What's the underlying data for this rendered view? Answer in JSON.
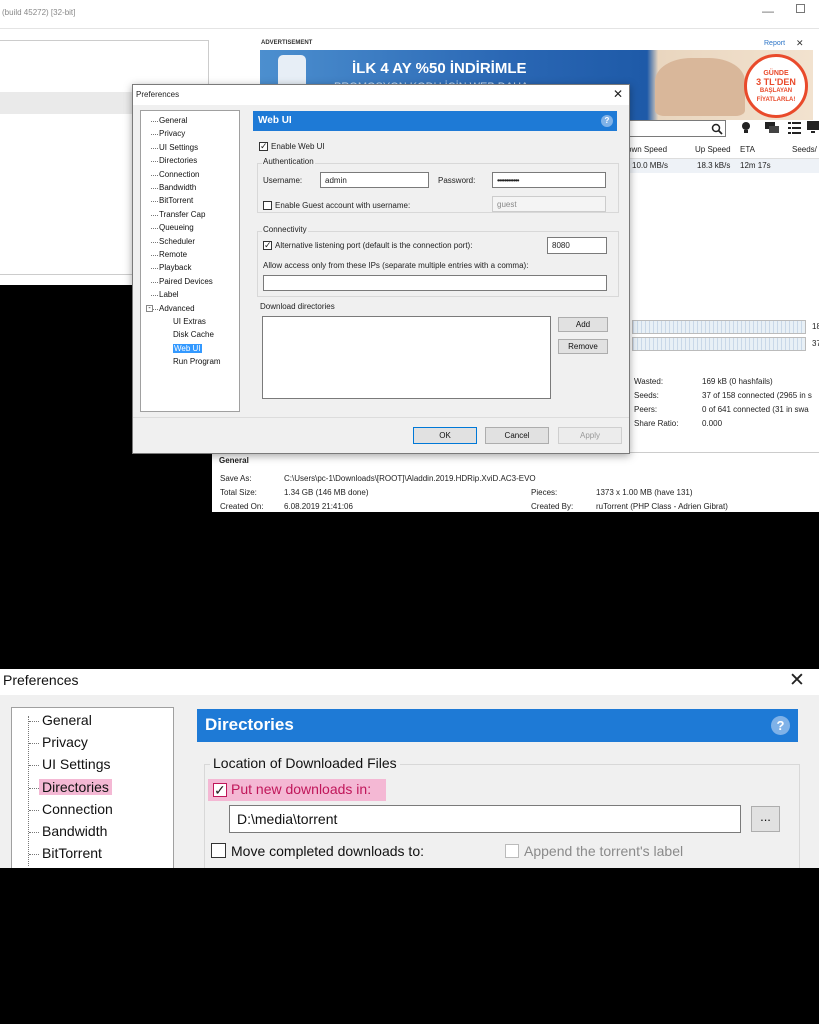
{
  "top": {
    "window_title": "(build 45272) [32-bit]",
    "ad": {
      "label": "ADVERTISEMENT",
      "report": "Report",
      "headline": "İLK 4 AY %50 İNDİRİMLE",
      "subline": "PROMOSYON KODU İÇİN WEB DAHA",
      "badge_line1": "GÜNDE",
      "badge_line2": "3 TL'DEN",
      "badge_line3": "BAŞLAYAN",
      "badge_line4": "FİYATLARLA!"
    },
    "search_placeholder": "ch",
    "columns": [
      "own Speed",
      "Up Speed",
      "ETA",
      "Seeds/"
    ],
    "row": {
      "down_speed": "10.0 MB/s",
      "up_speed": "18.3 kB/s",
      "eta": "12m 17s"
    },
    "side_numbers": [
      "18",
      "37"
    ],
    "stats": [
      {
        "label": "Wasted:",
        "value": "169 kB (0 hashfails)"
      },
      {
        "label": "Seeds:",
        "value": "37 of 158 connected (2965 in s"
      },
      {
        "label": "Peers:",
        "value": "0 of 641 connected (31 in swa"
      },
      {
        "label": "Share Ratio:",
        "value": "0.000"
      }
    ],
    "general": {
      "header": "General",
      "save_as_label": "Save As:",
      "save_as": "C:\\Users\\pc-1\\Downloads\\[ROOT]\\Aladdin.2019.HDRip.XviD.AC3-EVO",
      "total_size_label": "Total Size:",
      "total_size": "1.34 GB (146 MB done)",
      "created_on_label": "Created On:",
      "created_on": "6.08.2019 21:41:06",
      "pieces_label": "Pieces:",
      "pieces": "1373 x 1.00 MB (have 131)",
      "created_by_label": "Created By:",
      "created_by": "ruTorrent (PHP Class - Adrien Gibrat)"
    },
    "prefs": {
      "title": "Preferences",
      "tree": [
        "General",
        "Privacy",
        "UI Settings",
        "Directories",
        "Connection",
        "Bandwidth",
        "BitTorrent",
        "Transfer Cap",
        "Queueing",
        "Scheduler",
        "Remote",
        "Playback",
        "Paired Devices",
        "Label",
        "Advanced"
      ],
      "tree_children": [
        "UI Extras",
        "Disk Cache",
        "Web UI",
        "Run Program"
      ],
      "section_title": "Web UI",
      "enable_web_ui": "Enable Web UI",
      "authentication": "Authentication",
      "username_label": "Username:",
      "username": "admin",
      "password_label": "Password:",
      "password": "••••••••••••",
      "guest_label": "Enable Guest account with username:",
      "guest_value": "guest",
      "connectivity": "Connectivity",
      "alt_port_label": "Alternative listening port (default is the connection port):",
      "alt_port": "8080",
      "allow_ips_label": "Allow access only from these IPs (separate multiple entries with a comma):",
      "download_dirs": "Download directories",
      "add": "Add",
      "remove": "Remove",
      "ok": "OK",
      "cancel": "Cancel",
      "apply": "Apply"
    }
  },
  "bottom": {
    "title": "Preferences",
    "tree": [
      "General",
      "Privacy",
      "UI Settings",
      "Directories",
      "Connection",
      "Bandwidth",
      "BitTorrent"
    ],
    "section_title": "Directories",
    "location_group": "Location of Downloaded Files",
    "put_new_label": "Put new downloads in:",
    "put_new_path": "D:\\media\\torrent",
    "browse": "...",
    "move_completed_label": "Move completed downloads to:",
    "append_label_label": "Append the torrent's label"
  },
  "colors": {
    "accent": "#1e7ad6",
    "highlight": "#f4b8d4"
  }
}
